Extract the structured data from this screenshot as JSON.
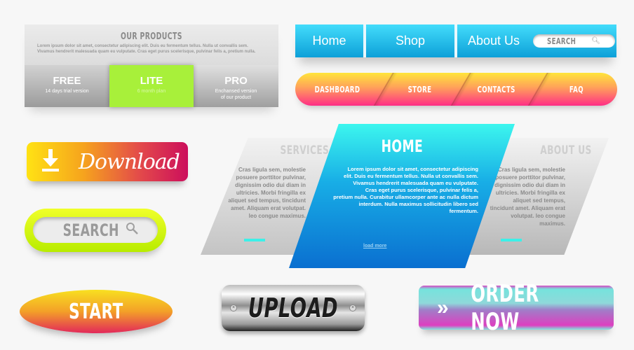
{
  "products": {
    "title": "OUR PRODUCTS",
    "description": "Lorem ipsum dolor sit amet, consectetur adipiscing elit. Duis eu fermentum tellus. Nulla ut convallis sem. Vivamus hendrerit malesuada quam eu vulputate. Cras eget purus scelerisque, pulvinar felis a, pretium nulla.",
    "plans": [
      {
        "name": "FREE",
        "desc": "14 days trial version"
      },
      {
        "name": "LITE",
        "desc": "6 month plan"
      },
      {
        "name": "PRO",
        "desc": "Enchansed version of our product"
      }
    ],
    "active_color": "#a8f03a"
  },
  "navbar": {
    "items": [
      "Home",
      "Shop",
      "About Us"
    ],
    "search_placeholder": "SEARCH",
    "search_icon": "search-icon",
    "color": "#1bb8e8"
  },
  "pillnav": {
    "items": [
      "DASHBOARD",
      "STORE",
      "CONTACTS",
      "FAQ"
    ]
  },
  "download": {
    "label": "Download",
    "icon": "download-arrow-icon"
  },
  "search_button": {
    "label": "SEARCH",
    "icon": "search-icon"
  },
  "tabs": {
    "services": {
      "title": "SERVICES",
      "body": "Cras ligula sem, molestie posuere porttitor pulvinar, dignissim odio dui diam in ultricies. Morbi fringilla ex aliquet sed tempus, tincidunt amet. Aliquam erat volutpat. leo congue maximus."
    },
    "home": {
      "title": "HOME",
      "para1": "Lorem ipsum dolor sit amet, consectetur adipiscing elit. Duis eu fermentum tellus. Nulla ut convallis sem. Vivamus hendrerit malesuada quam eu vulputate.",
      "para2": "Cras eget purus scelerisque, pulvinar felis a, pretium nulla. Curabitur ullamcorper ante ac nulla dictum interdum. Nulla maximus sollicitudin libero sed fermentum.",
      "load_more": "load more"
    },
    "about": {
      "title": "ABOUT US",
      "body": "Cras ligula sem, molestie posuere porttitor pulvinar, dignissim odio dui diam in ultricies. Morbi fringilla ex aliquet sed tempus, tincidunt amet. Aliquam erat volutpat. leo congue maximus."
    }
  },
  "start": {
    "label": "START"
  },
  "upload": {
    "label": "UPLOAD"
  },
  "order": {
    "label": "ORDER NOW",
    "icon": "double-chevron-right-icon",
    "chevrons": "»"
  }
}
